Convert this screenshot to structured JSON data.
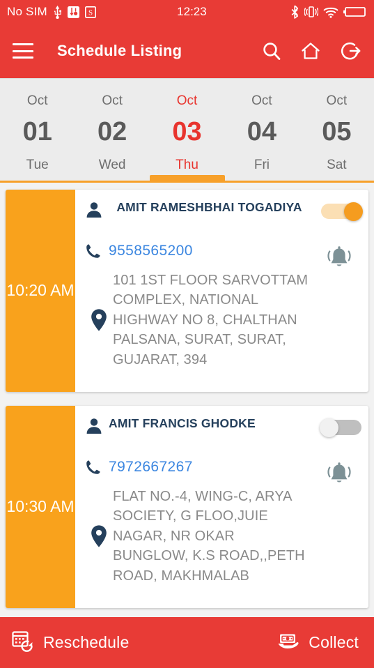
{
  "statusbar": {
    "carrier": "No SIM",
    "time": "12:23",
    "icons_left": [
      "usb-icon",
      "usb-tethering-icon",
      "screenshot-icon"
    ],
    "icons_right": [
      "bluetooth-icon",
      "vibrate-icon",
      "wifi-icon",
      "battery-icon"
    ]
  },
  "appbar": {
    "title": "Schedule Listing",
    "menu_icon": "hamburger-menu-icon",
    "search_icon": "search-icon",
    "home_icon": "home-icon",
    "logout_icon": "logout-icon",
    "background": "#e83b36"
  },
  "datestrip": {
    "accent": "#f7a02a",
    "active_color": "#e8342e",
    "days": [
      {
        "month": "Oct",
        "day": "01",
        "weekday": "Tue",
        "active": false
      },
      {
        "month": "Oct",
        "day": "02",
        "weekday": "Wed",
        "active": false
      },
      {
        "month": "Oct",
        "day": "03",
        "weekday": "Thu",
        "active": true
      },
      {
        "month": "Oct",
        "day": "04",
        "weekday": "Fri",
        "active": false
      },
      {
        "month": "Oct",
        "day": "05",
        "weekday": "Sat",
        "active": false
      }
    ]
  },
  "schedule": {
    "time_block_color": "#f9a21c",
    "items": [
      {
        "time": "10:20 AM",
        "name": "AMIT RAMESHBHAI TOGADIYA",
        "phone": "9558565200",
        "address": "101 1ST FLOOR SARVOTTAM COMPLEX, NATIONAL HIGHWAY NO 8, CHALTHAN PALSANA, SURAT, SURAT, GUJARAT, 394",
        "toggle_on": true,
        "bell_icon": "alarm-bell-icon",
        "person_icon": "person-icon",
        "phone_icon": "phone-icon",
        "location_icon": "location-pin-icon"
      },
      {
        "time": "10:30 AM",
        "name": "AMIT FRANCIS GHODKE",
        "phone": "7972667267",
        "address": "FLAT NO.-4, WING-C, ARYA SOCIETY, G FLOO,JUIE NAGAR, NR OKAR BUNGLOW, K.S ROAD,,PETH ROAD, MAKHMALAB",
        "toggle_on": false,
        "bell_icon": "alarm-bell-icon",
        "person_icon": "person-icon",
        "phone_icon": "phone-icon",
        "location_icon": "location-pin-icon"
      }
    ]
  },
  "bottombar": {
    "reschedule_label": "Reschedule",
    "reschedule_icon": "calendar-refresh-icon",
    "collect_label": "Collect",
    "collect_icon": "cash-collect-icon",
    "background": "#e83b36"
  }
}
